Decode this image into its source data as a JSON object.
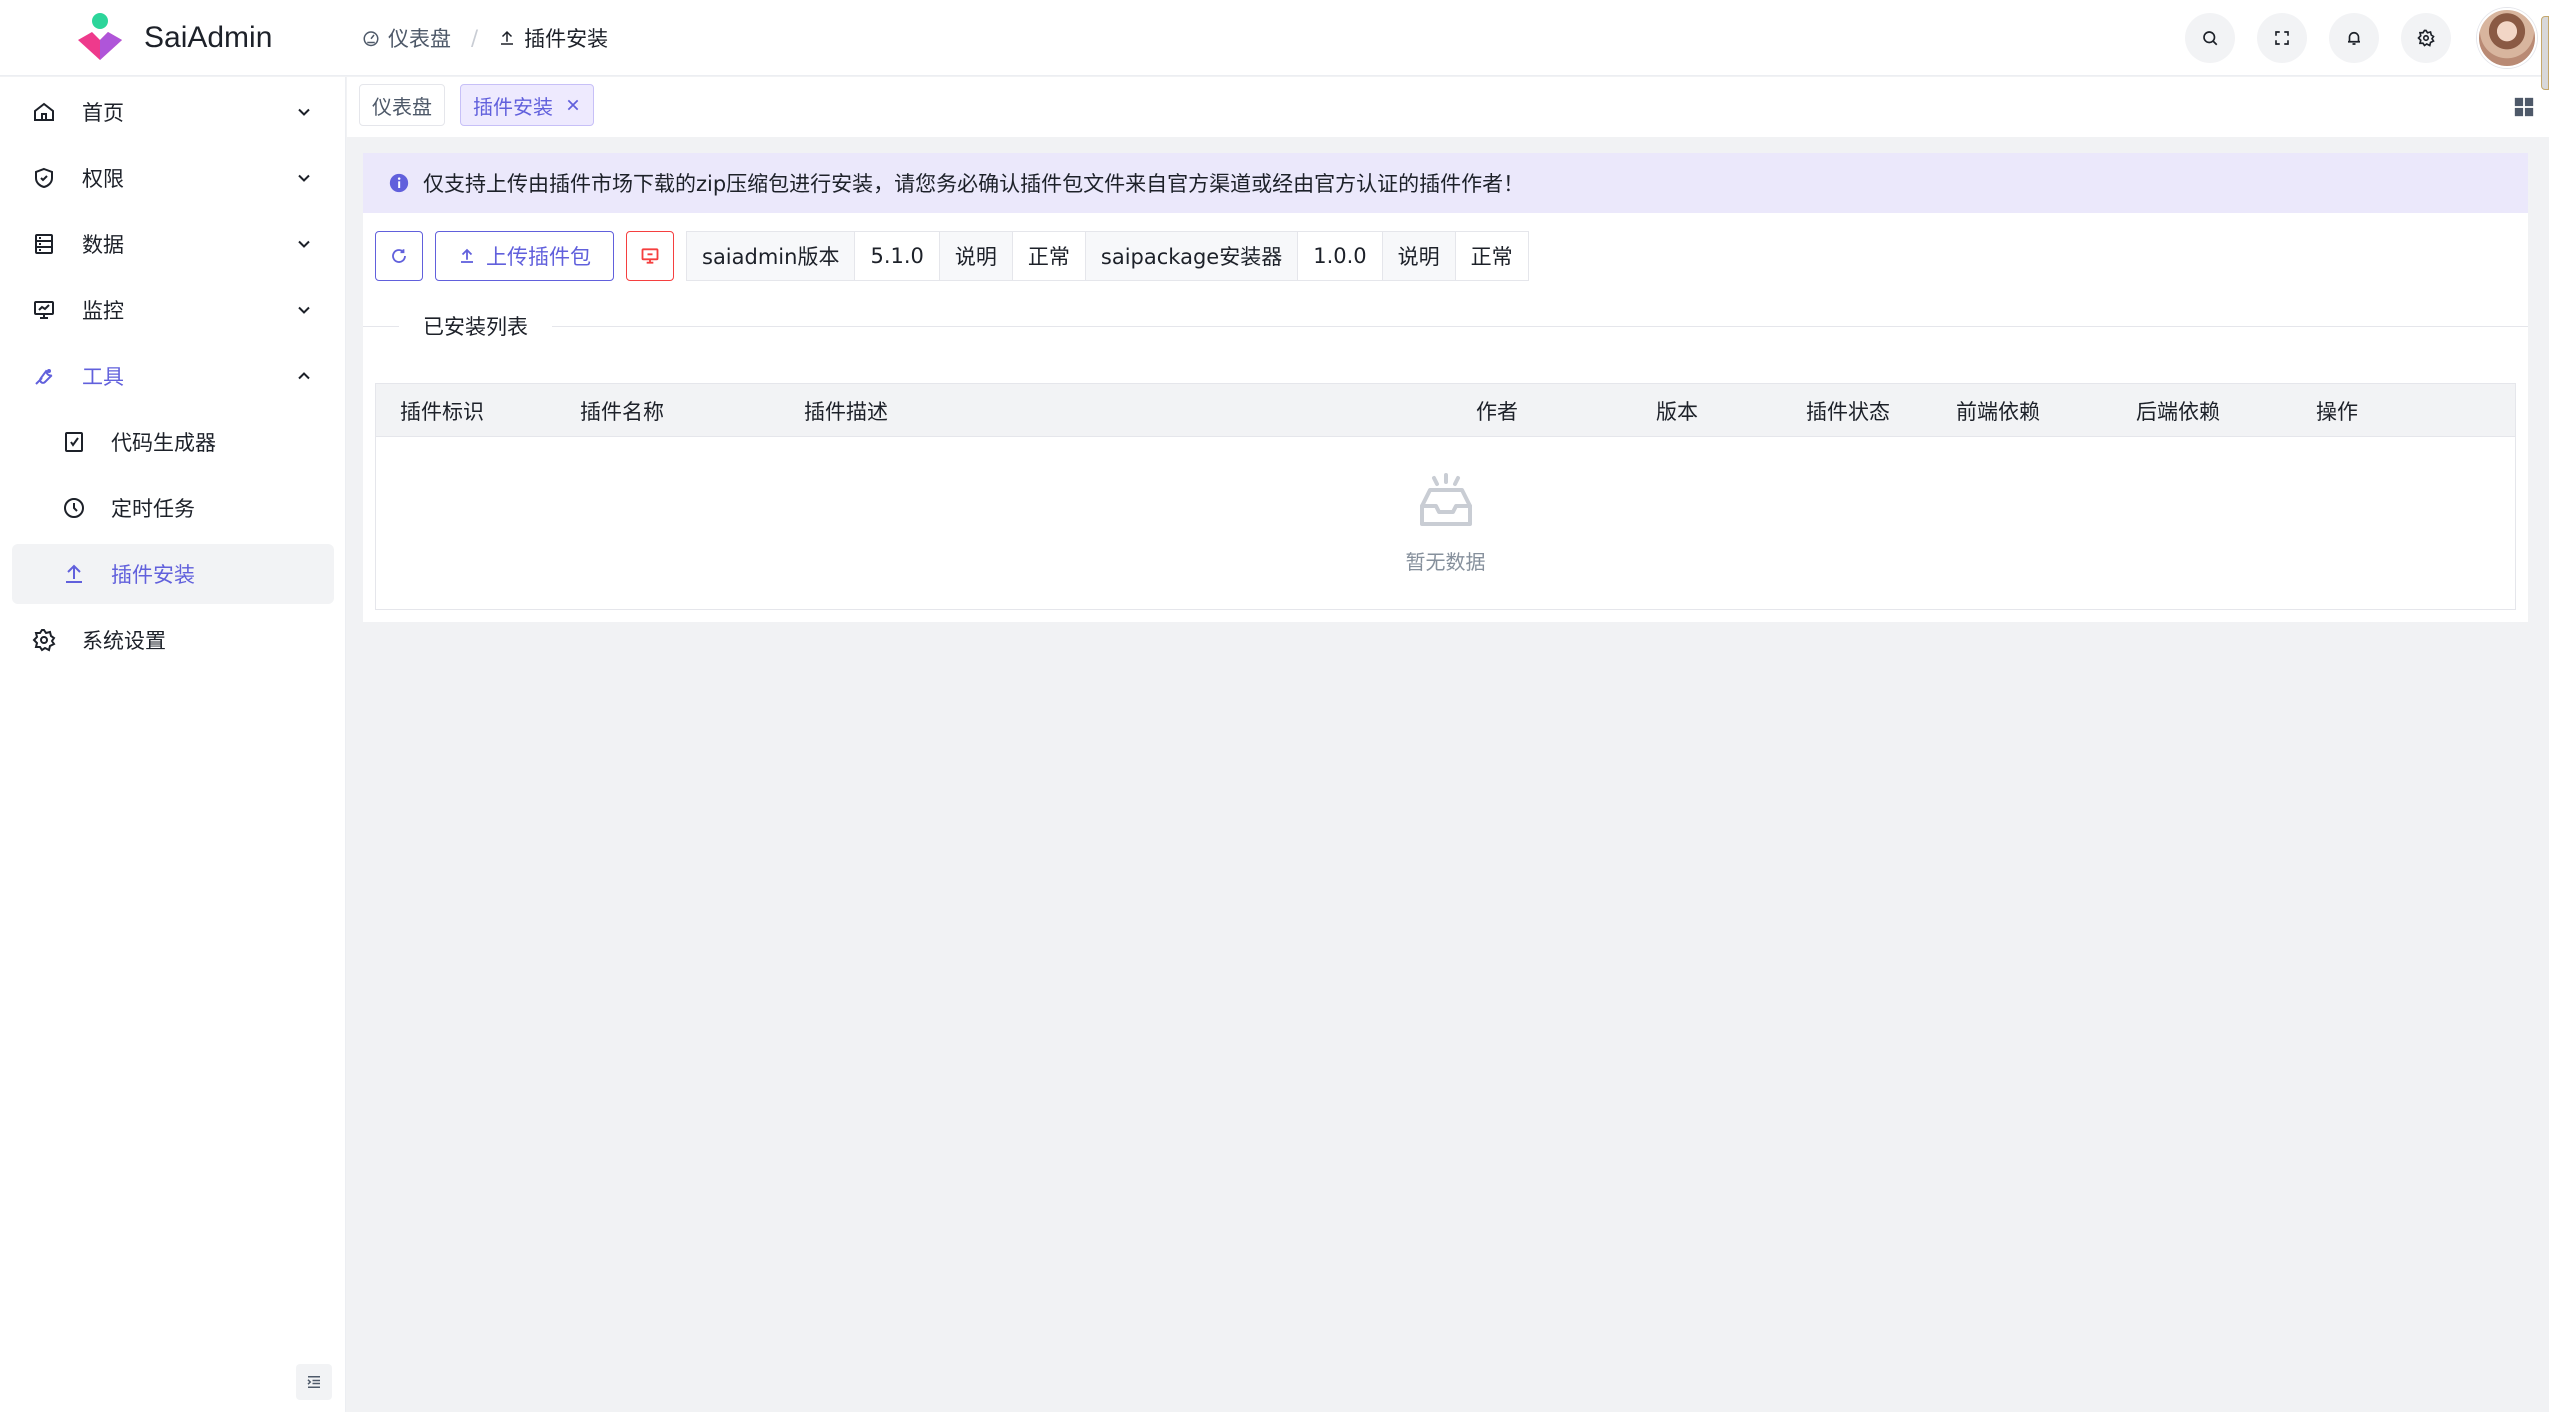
{
  "app": {
    "name": "SaiAdmin"
  },
  "breadcrumb": [
    {
      "label": "仪表盘",
      "icon": "dashboard-icon"
    },
    {
      "label": "插件安装",
      "icon": "upload-icon"
    }
  ],
  "header_actions": [
    "search-icon",
    "fullscreen-icon",
    "bell-icon",
    "settings-gear-icon",
    "avatar"
  ],
  "sidebar": {
    "items": [
      {
        "label": "首页",
        "icon": "home-icon",
        "expandable": true,
        "expanded": false
      },
      {
        "label": "权限",
        "icon": "shield-icon",
        "expandable": true,
        "expanded": false
      },
      {
        "label": "数据",
        "icon": "database-icon",
        "expandable": true,
        "expanded": false
      },
      {
        "label": "监控",
        "icon": "monitor-icon",
        "expandable": true,
        "expanded": false
      },
      {
        "label": "工具",
        "icon": "wrench-icon",
        "expandable": true,
        "expanded": true
      },
      {
        "label": "代码生成器",
        "icon": "code-file-icon",
        "sub": true
      },
      {
        "label": "定时任务",
        "icon": "clock-icon",
        "sub": true
      },
      {
        "label": "插件安装",
        "icon": "upload-icon",
        "sub": true,
        "active": true
      },
      {
        "label": "系统设置",
        "icon": "gear-icon"
      }
    ]
  },
  "tabs": [
    {
      "label": "仪表盘",
      "active": false
    },
    {
      "label": "插件安装",
      "active": true,
      "closable": true
    }
  ],
  "alert": {
    "text": "仅支持上传由插件市场下载的zip压缩包进行安装，请您务必确认插件包文件来自官方渠道或经由官方认证的插件作者！"
  },
  "toolbar": {
    "refresh_icon": "refresh-icon",
    "upload_label": "上传插件包",
    "terminal_icon": "monitor-alert-icon"
  },
  "version_info": [
    {
      "label": "saiadmin版本",
      "value": "5.1.0",
      "link": "说明",
      "status": "正常"
    },
    {
      "label": "saipackage安装器",
      "value": "1.0.0",
      "link": "说明",
      "status": "正常"
    }
  ],
  "section_title": "已安装列表",
  "table": {
    "columns": [
      "插件标识",
      "插件名称",
      "插件描述",
      "作者",
      "版本",
      "插件状态",
      "前端依赖",
      "后端依赖",
      "操作"
    ],
    "rows": [],
    "empty_text": "暂无数据"
  },
  "colors": {
    "primary": "#6160dc",
    "danger": "#f53f3f",
    "alert_bg": "#ebe8fb"
  }
}
